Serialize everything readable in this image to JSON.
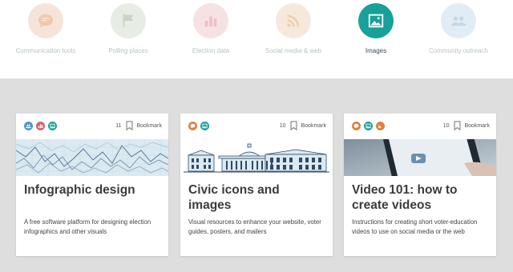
{
  "categories": [
    {
      "label": "Communication tools",
      "icon": "speech-bubble-icon",
      "bg": "#f6e4d8",
      "fg": "#efc9ae"
    },
    {
      "label": "Polling places",
      "icon": "flag-icon",
      "bg": "#e7ece4",
      "fg": "#c8d5c3"
    },
    {
      "label": "Election data",
      "icon": "bar-chart-icon",
      "bg": "#f7e2e3",
      "fg": "#efc0c3"
    },
    {
      "label": "Social media & web",
      "icon": "rss-icon",
      "bg": "#f6e9dc",
      "fg": "#ecd0b1"
    },
    {
      "label": "Images",
      "icon": "image-icon",
      "bg": "#17a19a",
      "fg": "#ffffff",
      "active": true
    },
    {
      "label": "Community outreach",
      "icon": "people-icon",
      "bg": "#e1edf4",
      "fg": "#c2d8e6"
    }
  ],
  "cards": [
    {
      "title": "Infographic design",
      "description": "A free software platform for designing election infographics and other visuals",
      "bookmark_count": "11",
      "bookmark_label": "Bookmark",
      "tags": [
        {
          "icon": "people-icon",
          "color": "#4f97c8"
        },
        {
          "icon": "bar-chart-icon",
          "color": "#d9616a"
        },
        {
          "icon": "image-icon",
          "color": "#17a19a"
        }
      ]
    },
    {
      "title": "Civic icons and images",
      "description": "Visual resources to enhance your website, voter guides, posters, and mailers",
      "bookmark_count": "10",
      "bookmark_label": "Bookmark",
      "tags": [
        {
          "icon": "speech-bubble-icon",
          "color": "#d9843f"
        },
        {
          "icon": "image-icon",
          "color": "#17a19a"
        }
      ]
    },
    {
      "title": "Video 101: how to create videos",
      "description": "Instructions for creating short voter-education videos to use on social media or the web",
      "bookmark_count": "10",
      "bookmark_label": "Bookmark",
      "tags": [
        {
          "icon": "speech-bubble-icon",
          "color": "#d9843f"
        },
        {
          "icon": "image-icon",
          "color": "#17a19a"
        },
        {
          "icon": "rss-icon",
          "color": "#d9843f"
        }
      ]
    }
  ]
}
